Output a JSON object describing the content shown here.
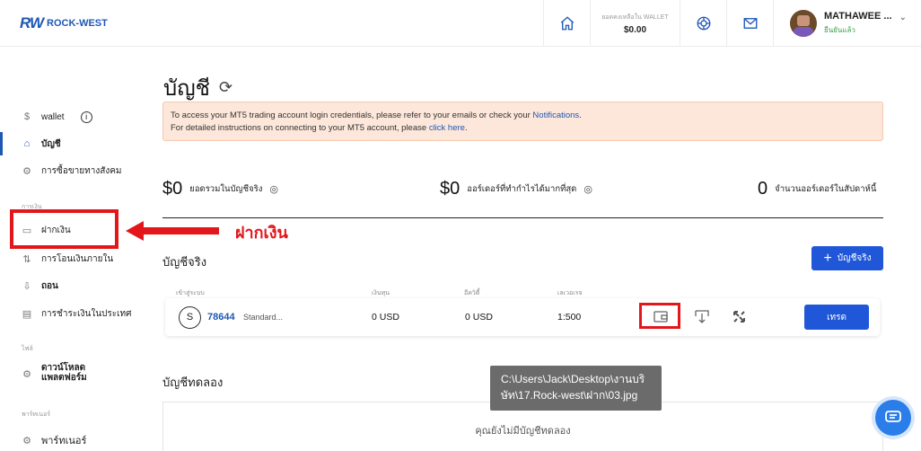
{
  "header": {
    "logo_mark": "RW",
    "logo_text": "ROCK-WEST",
    "wallet_label": "ยอดคงเหลือใน WALLET",
    "wallet_value": "$0.00",
    "user_name": "MATHAWEE ...",
    "user_status": "ยืนยันแล้ว",
    "icons": [
      "home-icon",
      "support-icon",
      "mail-icon",
      "chevron-down-icon"
    ]
  },
  "sidebar": {
    "wallet_label": "wallet",
    "items_top": [
      {
        "label": "บัญชี",
        "icon": "home-icon",
        "active": true
      },
      {
        "label": "การซื้อขายทางสังคม",
        "icon": "gear-icon"
      }
    ],
    "section_money": "การเงิน",
    "items_money": [
      {
        "label": "ฝากเงิน",
        "icon": "wallet-icon"
      },
      {
        "label": "การโอนเงินภายใน",
        "icon": "transfer-icon"
      },
      {
        "label": "ถอน",
        "icon": "withdraw-icon"
      },
      {
        "label": "การชำระเงินในประเทศ",
        "icon": "payment-icon"
      }
    ],
    "section_files": "ไฟล์",
    "download_label_1": "ดาวน์โหลด",
    "download_label_2": "แพลตฟอร์ม",
    "section_partner": "พาร์ทเนอร์",
    "partner_label": "พาร์ทเนอร์"
  },
  "annotation": {
    "label": "ฝากเงิน",
    "color": "#e3161b"
  },
  "main": {
    "title": "บัญชี",
    "notice_line1_prefix": "To access your MT5 trading account login credentials, please refer to your emails or check your ",
    "notice_line1_link": "Notifications",
    "notice_line1_suffix": ".",
    "notice_line2_prefix": "For detailed instructions on connecting to your MT5 account, please ",
    "notice_line2_link": "click here",
    "notice_line2_suffix": ".",
    "stats": [
      {
        "value": "$0",
        "label": "ยอดรวมในบัญชีจริง"
      },
      {
        "value": "$0",
        "label": "ออร์เดอร์ที่ทำกำไรได้มากที่สุด"
      },
      {
        "value": "0",
        "label": "จำนวนออร์เดอร์ในสัปดาห์นี้"
      }
    ],
    "real_section_title": "บัญชีจริง",
    "add_button_label": "บัญชีจริง",
    "columns": [
      "เข้าสู่ระบบ",
      "เงินทุน",
      "อีควิตี้",
      "เลเวอเรจ"
    ],
    "account": {
      "badge": "S",
      "id": "78644",
      "type": "Standard...",
      "funds": "0 USD",
      "equity": "0 USD",
      "leverage": "1:500"
    },
    "trade_button_label": "เทรด",
    "demo_section_title": "บัญชีทดลอง",
    "demo_empty": "คุณยังไม่มีบัญชีทดลอง"
  },
  "tooltip": {
    "line1": "C:\\Users\\Jack\\Desktop\\งานบริ",
    "line2": "ษัท\\17.Rock-west\\ฝาก\\03.jpg"
  },
  "colors": {
    "brand": "#1f57b5",
    "button": "#1f57d8",
    "notice_bg": "#fde7da",
    "highlight": "#e3161b"
  }
}
